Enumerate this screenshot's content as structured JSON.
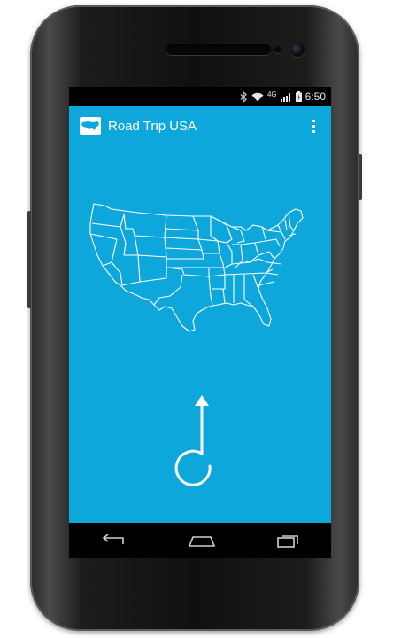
{
  "statusbar": {
    "network_type": "4G",
    "time": "6:50"
  },
  "actionbar": {
    "title": "Road Trip USA",
    "app_icon": "usa-map-icon",
    "menu_icon": "overflow-menu-icon"
  },
  "main": {
    "map_icon": "usa-states-map",
    "direction_icon": "turn-arrow-icon"
  },
  "navbar": {
    "icons": [
      "back-icon",
      "home-icon",
      "recent-apps-icon"
    ]
  },
  "colors": {
    "accent": "#0ea7dc",
    "statusbar": "#000000",
    "foreground": "#ffffff"
  }
}
